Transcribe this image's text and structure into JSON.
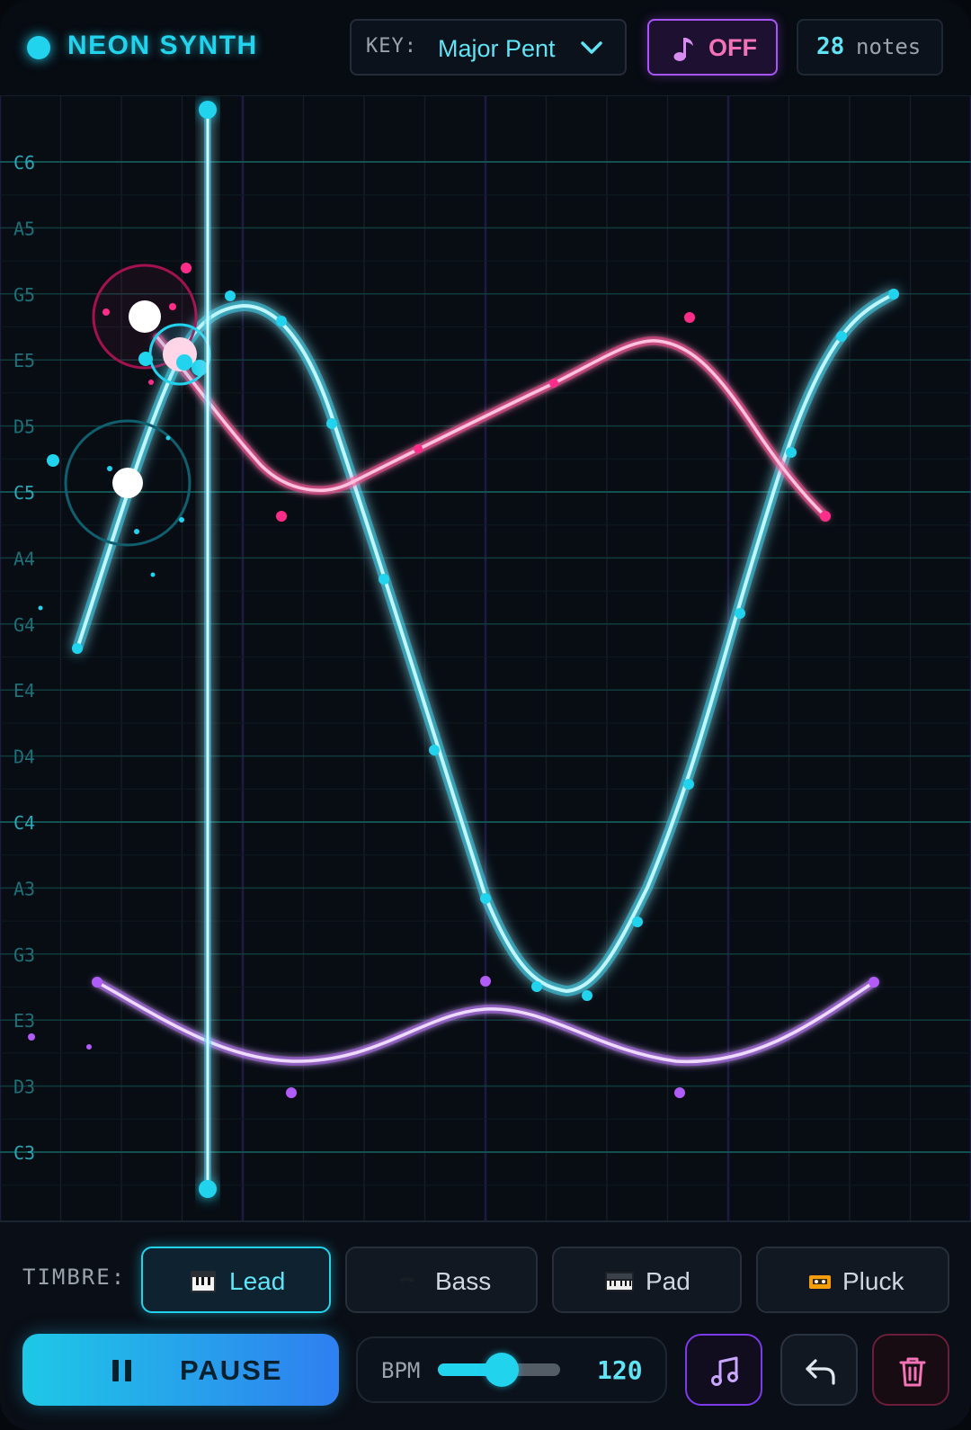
{
  "header": {
    "title": "NEON SYNTH",
    "key_label": "KEY:",
    "key_value": "Major Pent",
    "sound_label": "OFF",
    "note_count": "28",
    "note_count_unit": "notes"
  },
  "grid": {
    "note_labels": [
      "C6",
      "A5",
      "G5",
      "E5",
      "D5",
      "C5",
      "A4",
      "G4",
      "E4",
      "D4",
      "C4",
      "A3",
      "G3",
      "E3",
      "D3",
      "C3"
    ]
  },
  "colors": {
    "cyan": "#22d3ee",
    "pink": "#ff2d8a",
    "purple": "#b15cf7",
    "background": "#080d14"
  },
  "bottom": {
    "timbre_label": "TIMBRE:",
    "timbres": [
      {
        "label": "Lead",
        "icon": "piano-icon",
        "active": true
      },
      {
        "label": "Bass",
        "icon": "bass-icon",
        "active": false
      },
      {
        "label": "Pad",
        "icon": "keyboard-icon",
        "active": false
      },
      {
        "label": "Pluck",
        "icon": "cassette-icon",
        "active": false
      }
    ],
    "pause_label": "PAUSE",
    "bpm_label": "BPM",
    "bpm_value": "120",
    "bpm_fraction": 0.52
  }
}
